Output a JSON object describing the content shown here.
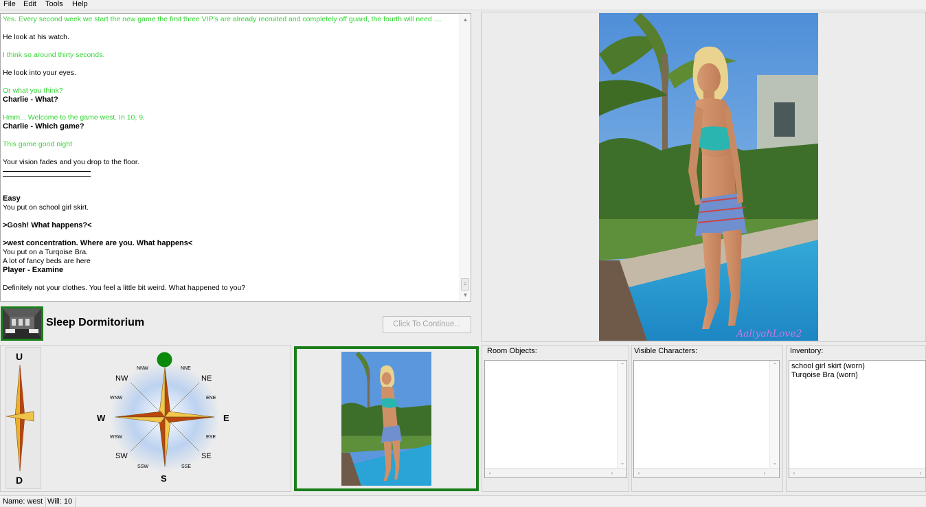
{
  "menu": {
    "file": "File",
    "edit": "Edit",
    "tools": "Tools",
    "help": "Help"
  },
  "story": [
    {
      "text": "Yes. Every second week we start the new game the first three VIP's are already recruited and completely off guard, the fourth will need ....",
      "style": "g"
    },
    {
      "text": "",
      "style": "gap"
    },
    {
      "text": "He look at his watch.",
      "style": "n"
    },
    {
      "text": "",
      "style": "gap"
    },
    {
      "text": "I think so around thirty seconds.",
      "style": "g"
    },
    {
      "text": "",
      "style": "gap"
    },
    {
      "text": "He look into your eyes.",
      "style": "n"
    },
    {
      "text": "",
      "style": "gap"
    },
    {
      "text": "Or what you think?",
      "style": "g"
    },
    {
      "text": "Charlie - What?",
      "style": "b"
    },
    {
      "text": "",
      "style": "gap"
    },
    {
      "text": "Hmm... Welcome to the game west. In 10, 9,",
      "style": "g"
    },
    {
      "text": "Charlie - Which game?",
      "style": "b"
    },
    {
      "text": "",
      "style": "gap"
    },
    {
      "text": "This game good night",
      "style": "g"
    },
    {
      "text": "",
      "style": "gap"
    },
    {
      "text": "Your vision fades and you drop to the floor.",
      "style": "n"
    },
    {
      "text": "",
      "style": "rule"
    },
    {
      "text": "",
      "style": "rule"
    },
    {
      "text": "",
      "style": "gap"
    },
    {
      "text": "",
      "style": "gap"
    },
    {
      "text": "Easy",
      "style": "b"
    },
    {
      "text": "You put on school girl skirt.",
      "style": "n"
    },
    {
      "text": "",
      "style": "gap"
    },
    {
      "text": ">Gosh! What happens?<",
      "style": "b"
    },
    {
      "text": "",
      "style": "gap"
    },
    {
      "text": ">west concentration. Where are you. What happens<",
      "style": "b"
    },
    {
      "text": "You put on a Turqoise Bra.",
      "style": "n"
    },
    {
      "text": "A lot of fancy beds are here",
      "style": "n"
    },
    {
      "text": "Player - Examine",
      "style": "b"
    },
    {
      "text": "",
      "style": "gap"
    },
    {
      "text": "Definitely not your clothes. You feel a little bit weird. What happened to you?",
      "style": "n"
    }
  ],
  "location": {
    "name": "Sleep Dormitorium",
    "continue_label": "Click To Continue..."
  },
  "compass": {
    "up": "U",
    "down": "D",
    "n": "",
    "s": "S",
    "e": "E",
    "w": "W",
    "ne": "NE",
    "nw": "NW",
    "se": "SE",
    "sw": "SW",
    "nne": "NNE",
    "nnw": "NNW",
    "ene": "ENE",
    "wnw": "WNW",
    "ese": "ESE",
    "wsw": "WSW",
    "sse": "SSE",
    "ssw": "SSW",
    "available_color": "#0a8a0a"
  },
  "picture_watermark": "AaliyahLove2",
  "room_objects": {
    "title": "Room Objects:",
    "items": []
  },
  "visible_characters": {
    "title": "Visible Characters:",
    "items": []
  },
  "inventory": {
    "title": "Inventory:",
    "items": [
      "school girl skirt (worn)",
      "Turqoise Bra (worn)"
    ]
  },
  "status": {
    "name": "Name: west",
    "will": "Will: 10"
  },
  "colors": {
    "highlight_border": "#1a7f1a",
    "npc_text": "#33d633"
  }
}
